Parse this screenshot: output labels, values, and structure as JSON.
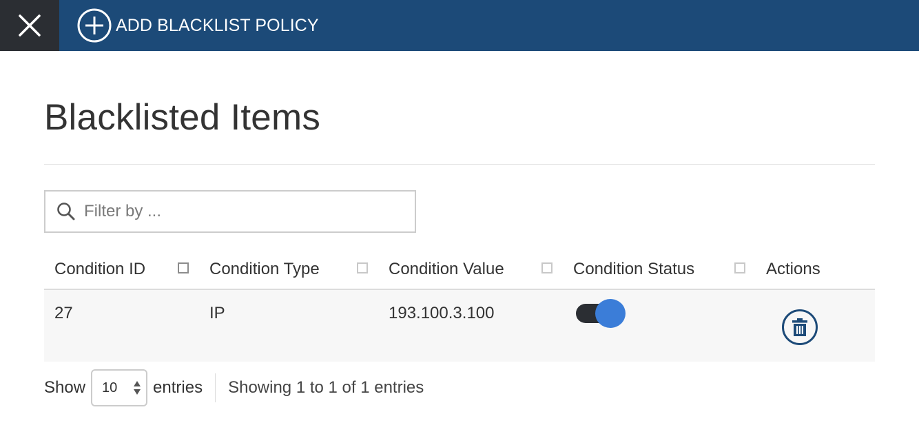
{
  "topbar": {
    "close_icon": "close-icon",
    "add_icon": "plus-circle-icon",
    "add_label": "ADD BLACKLIST POLICY",
    "bar_color": "#1c4a78",
    "close_bg_color": "#2b2e33"
  },
  "page": {
    "title": "Blacklisted Items"
  },
  "search": {
    "icon": "search-icon",
    "placeholder": "Filter by ...",
    "value": ""
  },
  "table": {
    "columns": [
      {
        "label": "Condition ID"
      },
      {
        "label": "Condition Type"
      },
      {
        "label": "Condition Value"
      },
      {
        "label": "Condition Status"
      },
      {
        "label": "Actions"
      }
    ],
    "rows": [
      {
        "condition_id": "27",
        "condition_type": "IP",
        "condition_value": "193.100.3.100",
        "condition_status": "enabled",
        "action_icon": "trash-icon"
      }
    ]
  },
  "footer": {
    "show_label": "Show",
    "page_length": "10",
    "entries_label": "entries",
    "info": "Showing 1 to 1 of 1 entries"
  },
  "colors": {
    "accent": "#3b7dd8",
    "primary": "#1c4a78"
  }
}
